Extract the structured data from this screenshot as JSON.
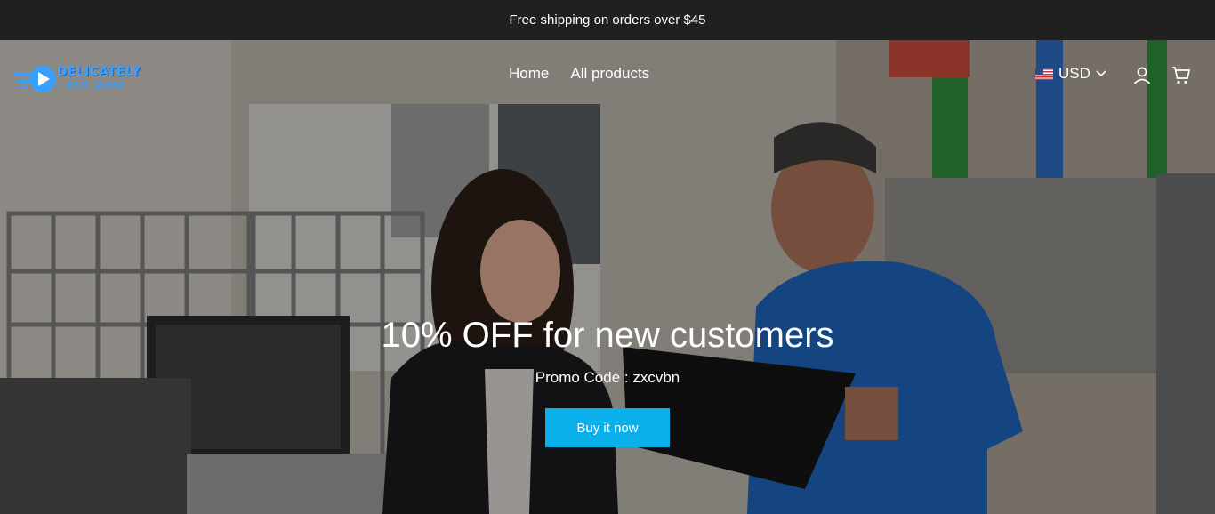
{
  "announcement": {
    "text": "Free shipping on orders over $45"
  },
  "brand": {
    "name": "DELICATELY",
    "tagline": "- EST. 2000 -"
  },
  "nav": {
    "items": [
      {
        "label": "Home"
      },
      {
        "label": "All products"
      }
    ]
  },
  "currency": {
    "selected": "USD",
    "flag_icon": "us-flag-icon",
    "chevron_icon": "chevron-down-icon"
  },
  "icons": {
    "account": "user-icon",
    "cart": "cart-icon"
  },
  "hero": {
    "title": "10% OFF for new customers",
    "promo": "Promo Code : zxcvbn",
    "button_label": "Buy it now",
    "button_color": "#0ab0ea"
  },
  "colors": {
    "announcement_bg": "#202020",
    "brand_blue": "#3aa0ff"
  }
}
